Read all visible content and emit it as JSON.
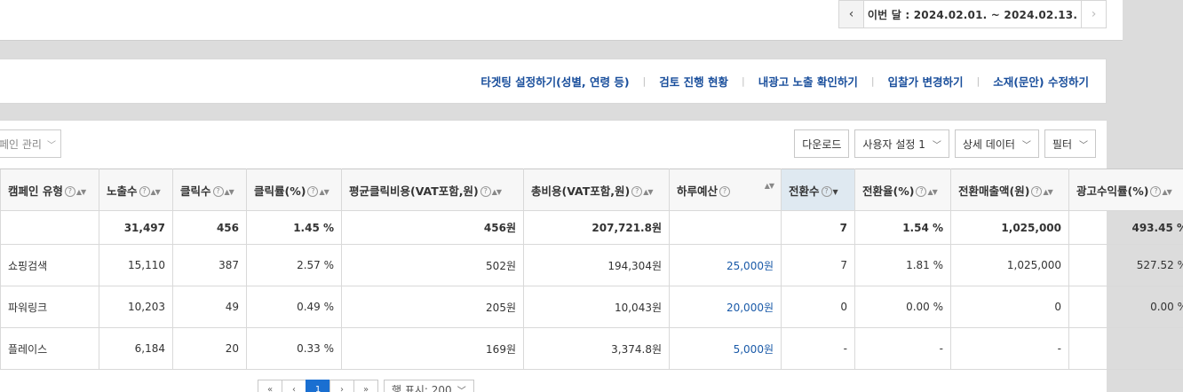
{
  "period": {
    "prev_icon": "chevron-left-icon",
    "next_icon": "chevron-right-icon",
    "label": "이번 달 : 2024.02.01. ~ 2024.02.13.",
    "prev_glyph": "‹",
    "next_glyph": "›"
  },
  "links": [
    "타겟팅 설정하기(성별, 연령 등)",
    "검토 진행 현황",
    "내광고 노출 확인하기",
    "입찰가 변경하기",
    "소재(문안) 수정하기"
  ],
  "campaign_select": {
    "label": "페인 관리"
  },
  "toolbar": {
    "download": "다운로드",
    "user_setting": "사용자 설정 1",
    "detail_data": "상세 데이터",
    "filter": "필터"
  },
  "table": {
    "headers": [
      "캠페인 유형",
      "노출수",
      "클릭수",
      "클릭률(%)",
      "평균클릭비용(VAT포함,원)",
      "총비용(VAT포함,원)",
      "하루예산",
      "전환수",
      "전환율(%)",
      "전환매출액(원)",
      "광고수익률(%)"
    ],
    "total": [
      "",
      "31,497",
      "456",
      "1.45 %",
      "456원",
      "207,721.8원",
      "",
      "7",
      "1.54 %",
      "1,025,000",
      "493.45 %"
    ],
    "rows": [
      [
        "쇼핑검색",
        "15,110",
        "387",
        "2.57 %",
        "502원",
        "194,304원",
        "25,000원",
        "7",
        "1.81 %",
        "1,025,000",
        "527.52 %"
      ],
      [
        "파워링크",
        "10,203",
        "49",
        "0.49 %",
        "205원",
        "10,043원",
        "20,000원",
        "0",
        "0.00 %",
        "0",
        "0.00 %"
      ],
      [
        "플레이스",
        "6,184",
        "20",
        "0.33 %",
        "169원",
        "3,374.8원",
        "5,000원",
        "-",
        "-",
        "-",
        "-"
      ]
    ]
  },
  "pager": {
    "first": "«",
    "prev": "‹",
    "current": "1",
    "next": "›",
    "last": "»",
    "rows_label": "행 표시: 200"
  },
  "colors": {
    "link": "#1a4f9c",
    "budget_link": "#1a5aa8",
    "sorted_header": "#dfe9f1",
    "active_page": "#1a6fd1"
  }
}
